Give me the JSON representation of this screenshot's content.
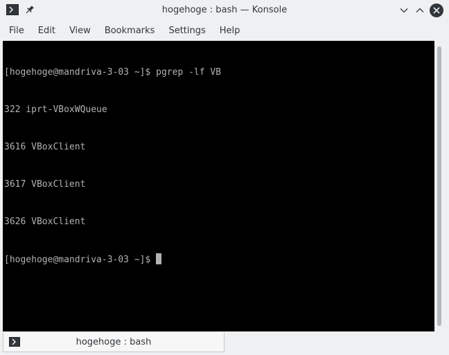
{
  "window": {
    "title": "hogehoge : bash — Konsole"
  },
  "menu": {
    "items": [
      {
        "label": "File"
      },
      {
        "label": "Edit"
      },
      {
        "label": "View"
      },
      {
        "label": "Bookmarks"
      },
      {
        "label": "Settings"
      },
      {
        "label": "Help"
      }
    ]
  },
  "terminal": {
    "lines": [
      "[hogehoge@mandriva-3-03 ~]$ pgrep -lf VB",
      "322 iprt-VBoxWQueue",
      "3616 VBoxClient",
      "3617 VBoxClient",
      "3626 VBoxClient",
      "[hogehoge@mandriva-3-03 ~]$ "
    ],
    "background_color": "#000000",
    "text_color": "#b2b2b2"
  },
  "tabs": [
    {
      "label": "hogehoge : bash",
      "icon": "terminal-icon"
    }
  ],
  "icons": {
    "app": "terminal-icon",
    "pin": "pin-icon",
    "minimize": "chevron-down-icon",
    "maximize": "chevron-up-icon",
    "close": "close-icon"
  }
}
